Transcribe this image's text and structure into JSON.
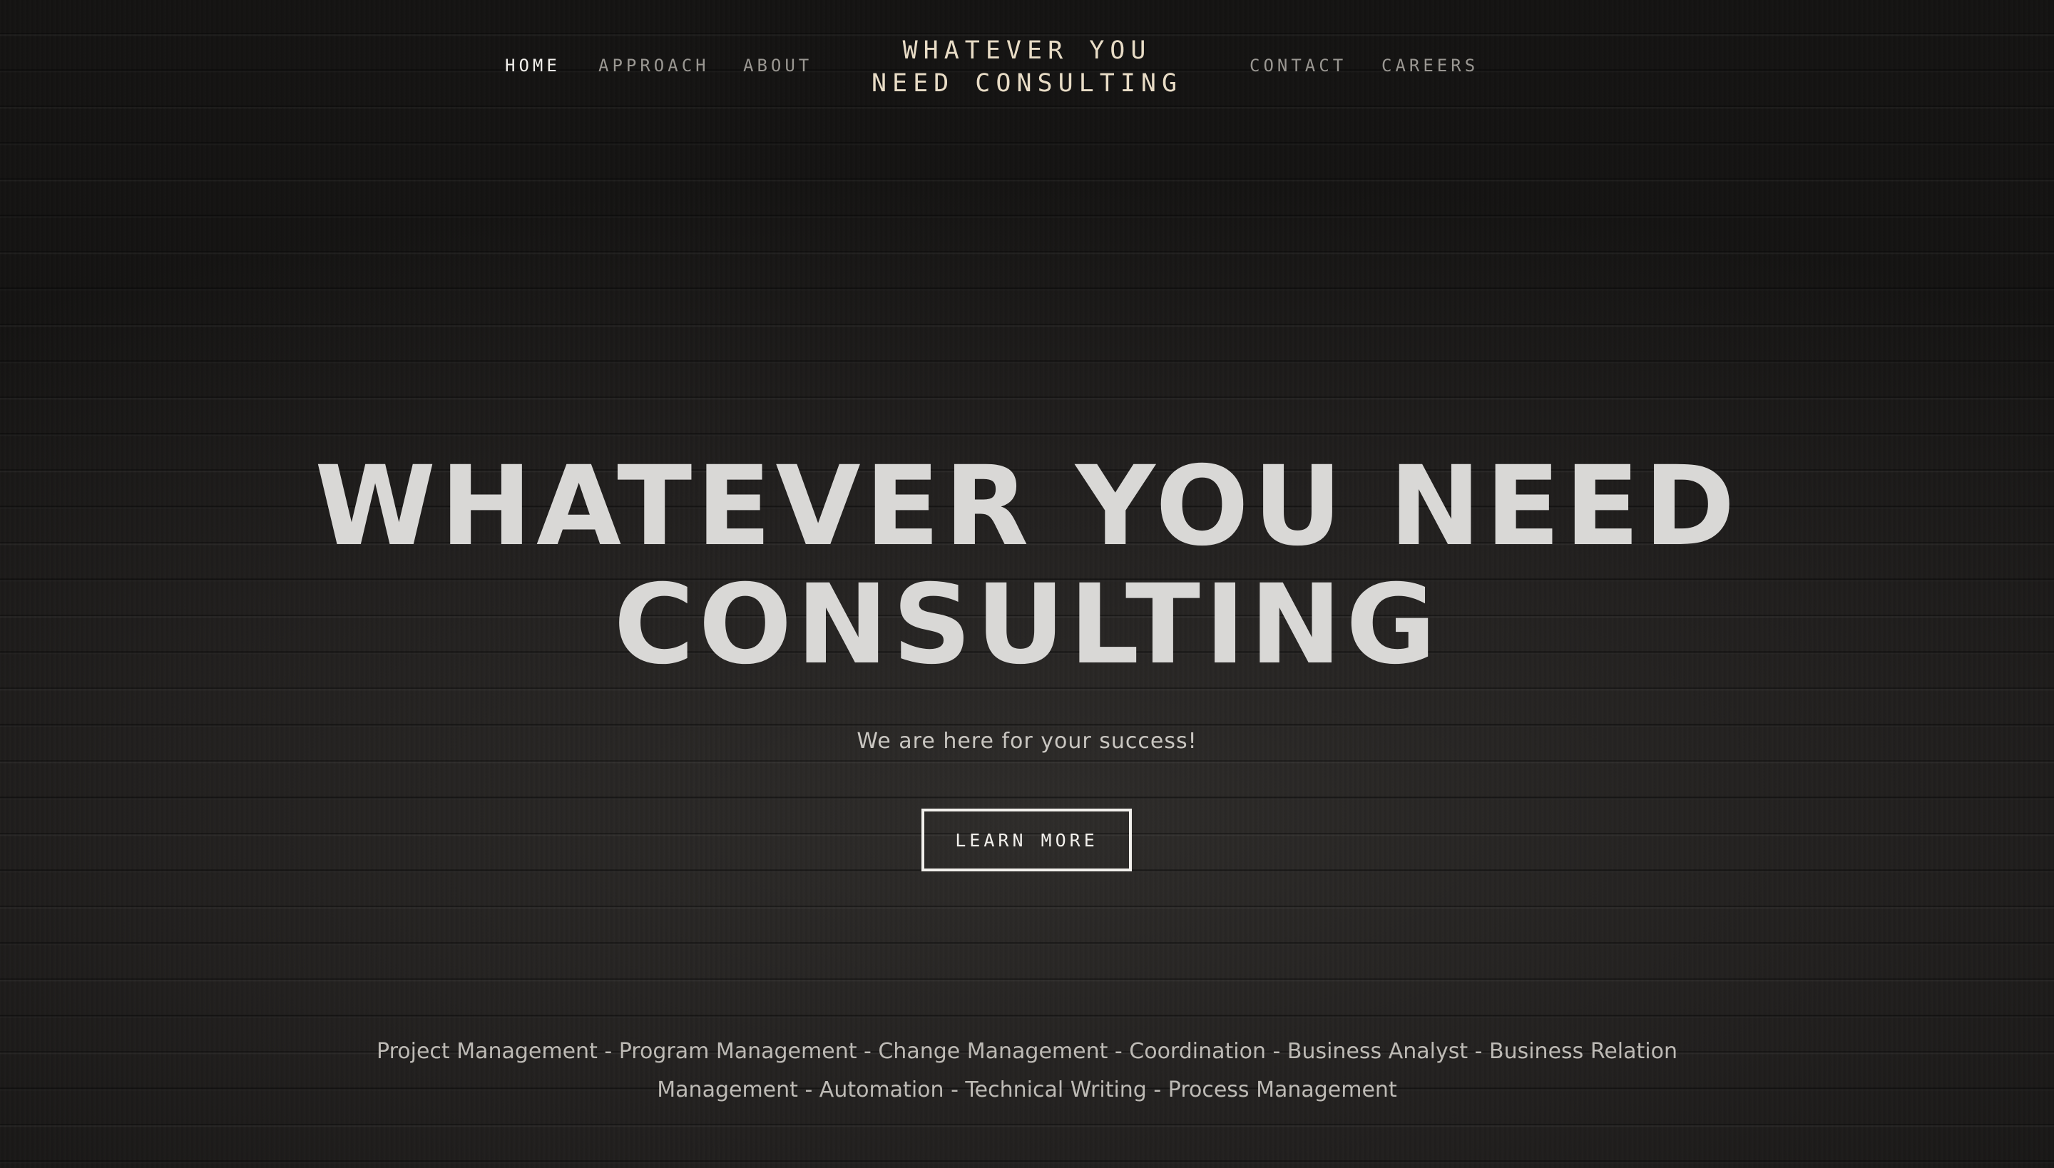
{
  "nav": {
    "left_items": [
      {
        "label": "HOME"
      },
      {
        "label": "APPROACH"
      },
      {
        "label": "ABOUT"
      }
    ],
    "right_items": [
      {
        "label": "CONTACT"
      },
      {
        "label": "CAREERS"
      }
    ],
    "active": "HOME"
  },
  "site_title": {
    "line1": "WHATEVER YOU",
    "line2": "NEED CONSULTING"
  },
  "hero": {
    "title_line1": "WHATEVER YOU NEED",
    "title_line2": "CONSULTING",
    "subtitle": "We are here for your success!",
    "cta_label": "LEARN MORE"
  },
  "services": {
    "text": "Project Management - Program Management - Change Management - Coordination - Business Analyst - Business Relation Management - Automation - Technical Writing - Process Management"
  },
  "colors": {
    "background": "#1c1b1a",
    "site_title": "#e8dcc6",
    "nav_active": "#f2f0ec",
    "nav_inactive": "#9a9792",
    "hero_title": "#d9d8d6"
  }
}
